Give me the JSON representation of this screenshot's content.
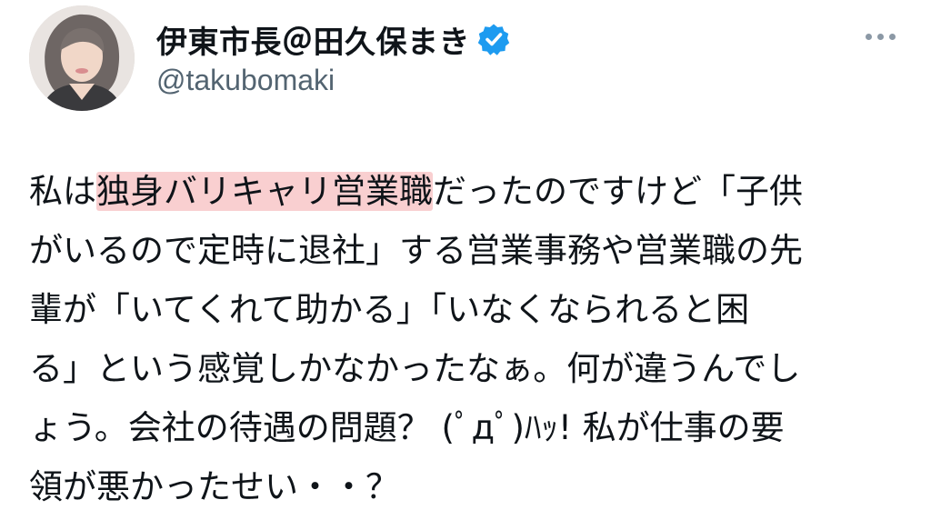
{
  "profile": {
    "display_name": "伊東市長＠田久保まき",
    "handle": "@takubomaki",
    "verified": true,
    "avatar_alt": "profile photo"
  },
  "menu": {
    "icon": "more-horizontal-icon"
  },
  "colors": {
    "verified_badge": "#1d9bf0",
    "handle_text": "#536471",
    "highlight": "#f9cfd0",
    "text": "#0f1419"
  },
  "tweet": {
    "lines": [
      {
        "pre": "私は",
        "highlight": "独身バリキャリ営業職",
        "post": "だったのですけど「子供"
      },
      {
        "pre": "がいるので定時に退社」する営業事務や営業職の先"
      },
      {
        "pre": "輩が「いてくれて助かる」「いなくなられると困"
      },
      {
        "pre": "る」という感覚しかなかったなぁ。何が違うんでし"
      },
      {
        "pre": "ょう。会社の待遇の問題？ (ﾟдﾟ)ﾊｯ! 私が仕事の要"
      },
      {
        "pre": "領が悪かったせい・・？"
      }
    ]
  }
}
